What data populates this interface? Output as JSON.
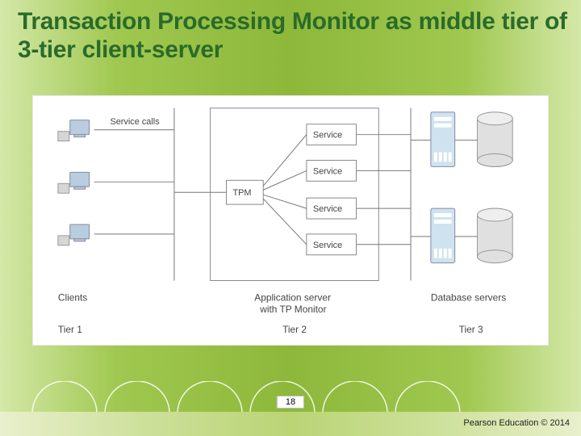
{
  "title": "Transaction Processing Monitor as middle tier of 3-tier client-server",
  "diagram": {
    "service_calls_label": "Service calls",
    "tpm_label": "TPM",
    "service_labels": [
      "Service",
      "Service",
      "Service",
      "Service"
    ],
    "clients_label": "Clients",
    "app_server_label_1": "Application server",
    "app_server_label_2": "with TP Monitor",
    "db_servers_label": "Database servers",
    "tier1_label": "Tier 1",
    "tier2_label": "Tier 2",
    "tier3_label": "Tier 3"
  },
  "pagenum": "18",
  "copyright": "Pearson Education © 2014"
}
